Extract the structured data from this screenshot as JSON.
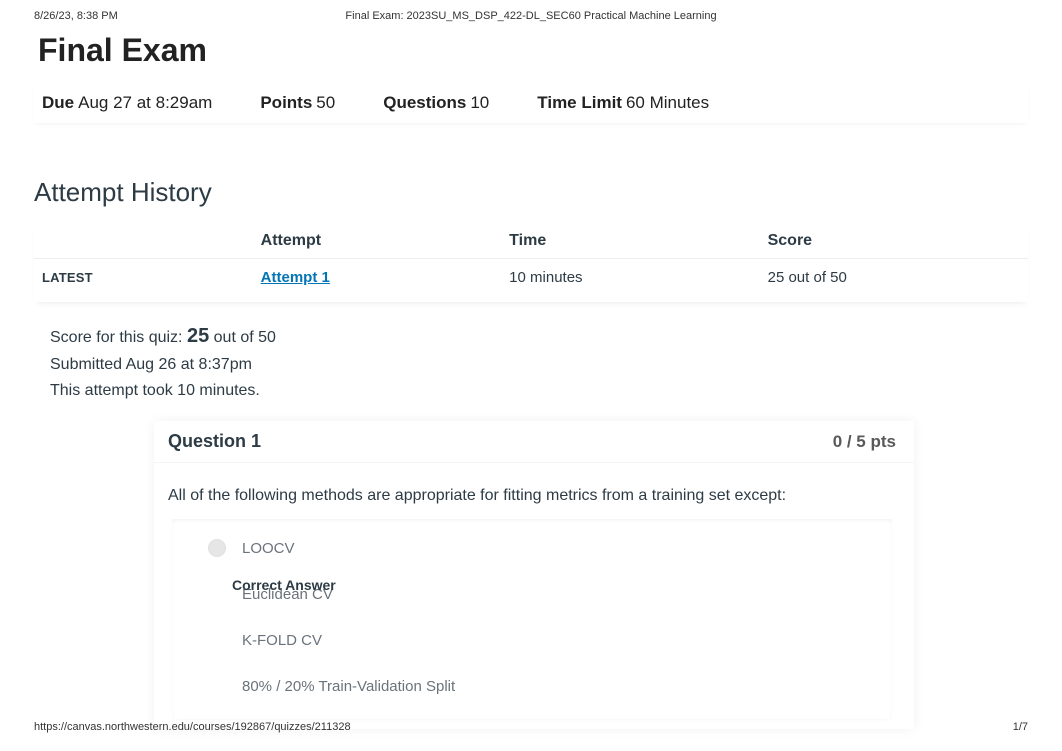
{
  "print": {
    "datetime": "8/26/23, 8:38 PM",
    "doc_title": "Final Exam: 2023SU_MS_DSP_422-DL_SEC60 Practical Machine Learning",
    "footer_url": "https://canvas.northwestern.edu/courses/192867/quizzes/211328",
    "page_indicator": "1/7"
  },
  "title": "Final Exam",
  "meta": {
    "due_label": "Due",
    "due_value": "Aug 27 at 8:29am",
    "points_label": "Points",
    "points_value": "50",
    "questions_label": "Questions",
    "questions_value": "10",
    "timelimit_label": "Time Limit",
    "timelimit_value": "60 Minutes"
  },
  "history": {
    "heading": "Attempt History",
    "cols": {
      "c0": "",
      "c1": "Attempt",
      "c2": "Time",
      "c3": "Score"
    },
    "row": {
      "latest": "LATEST",
      "attempt": "Attempt 1",
      "time": "10 minutes",
      "score": "25 out of 50"
    }
  },
  "summary": {
    "score_prefix": "Score for this quiz: ",
    "score_big": "25",
    "score_suffix": " out of 50",
    "submitted": "Submitted Aug 26 at 8:37pm",
    "duration": "This attempt took 10 minutes."
  },
  "question": {
    "title": "Question 1",
    "pts": "0 / 5 pts",
    "prompt": "All of the following methods are appropriate for fitting metrics from a training set except:",
    "correct_label": "Correct Answer",
    "answers": {
      "a": "LOOCV",
      "b": "Euclidean CV",
      "c": "K-FOLD CV",
      "d": "80% / 20% Train-Validation Split"
    }
  }
}
